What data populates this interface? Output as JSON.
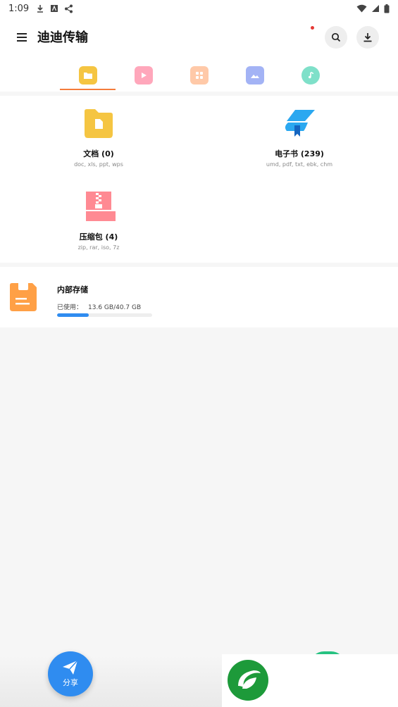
{
  "status_bar": {
    "time": "1:09"
  },
  "app_bar": {
    "title": "迪迪传输"
  },
  "tabs": [
    {
      "icon": "folder-icon",
      "color": "#f5c542",
      "selected": true
    },
    {
      "icon": "video-icon",
      "color": "#ff9eb3"
    },
    {
      "icon": "apps-icon",
      "color": "#ffc9a8"
    },
    {
      "icon": "image-icon",
      "color": "#9fb2f5"
    },
    {
      "icon": "music-icon",
      "color": "#7fe0c9"
    }
  ],
  "categories": {
    "docs": {
      "name": "文档 (0)",
      "ext": "doc, xls, ppt, wps"
    },
    "ebooks": {
      "name": "电子书 (239)",
      "ext": "umd, pdf, txt, ebk, chm"
    },
    "archives": {
      "name": "压缩包 (4)",
      "ext": "zip, rar, iso, 7z"
    }
  },
  "storage": {
    "title": "内部存储",
    "used_label": "已使用：",
    "used_value": "13.6 GB/40.7 GB",
    "used_fraction": 0.334
  },
  "share_fab": {
    "label": "分享"
  },
  "colors": {
    "accent": "#f57c3b",
    "primary": "#2f8cf0",
    "folder": "#f5c542",
    "archive": "#ff7c86",
    "storage": "#ffa046"
  }
}
